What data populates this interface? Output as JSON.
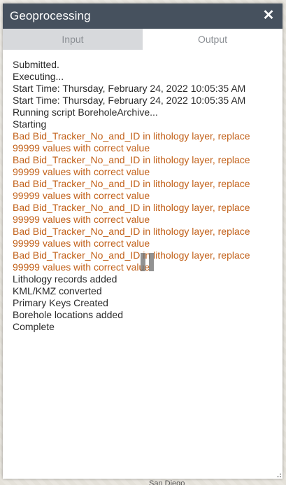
{
  "window": {
    "title": "Geoprocessing",
    "close_glyph": "✕"
  },
  "tabs": [
    {
      "label": "Input",
      "selected": false
    },
    {
      "label": "Output",
      "selected": true
    }
  ],
  "output": {
    "messages": [
      {
        "text": "Submitted.",
        "type": "info"
      },
      {
        "text": "Executing...",
        "type": "info"
      },
      {
        "text": "Start Time: Thursday, February 24, 2022 10:05:35 AM",
        "type": "info"
      },
      {
        "text": "Start Time: Thursday, February 24, 2022 10:05:35 AM",
        "type": "info"
      },
      {
        "text": "Running script BoreholeArchive...",
        "type": "info"
      },
      {
        "text": "Starting",
        "type": "info"
      },
      {
        "text": "Bad Bid_Tracker_No_and_ID in lithology layer, replace 99999 values with correct value",
        "type": "warning"
      },
      {
        "text": "Bad Bid_Tracker_No_and_ID in lithology layer, replace 99999 values with correct value",
        "type": "warning"
      },
      {
        "text": "Bad Bid_Tracker_No_and_ID in lithology layer, replace 99999 values with correct value",
        "type": "warning"
      },
      {
        "text": "Bad Bid_Tracker_No_and_ID in lithology layer, replace 99999 values with correct value",
        "type": "warning"
      },
      {
        "text": "Bad Bid_Tracker_No_and_ID in lithology layer, replace 99999 values with correct value",
        "type": "warning"
      },
      {
        "text": "Bad Bid_Tracker_No_and_ID in lithology layer, replace 99999 values with correct value",
        "type": "warning"
      },
      {
        "text": "Lithology records added",
        "type": "info"
      },
      {
        "text": "KML/KMZ converted",
        "type": "info"
      },
      {
        "text": "Primary Keys Created",
        "type": "info"
      },
      {
        "text": "Borehole locations added",
        "type": "info"
      },
      {
        "text": "Complete",
        "type": "info"
      }
    ]
  },
  "map": {
    "label": "San Diego"
  },
  "colors": {
    "titlebar": "#46515e",
    "warning_text": "#c2611a",
    "info_text": "#2b2b2b",
    "tab_inactive_bg": "#d7d9dc"
  },
  "icons": {
    "close": "close-icon",
    "busy": "pause-icon",
    "resize": "resize-grip-icon"
  }
}
